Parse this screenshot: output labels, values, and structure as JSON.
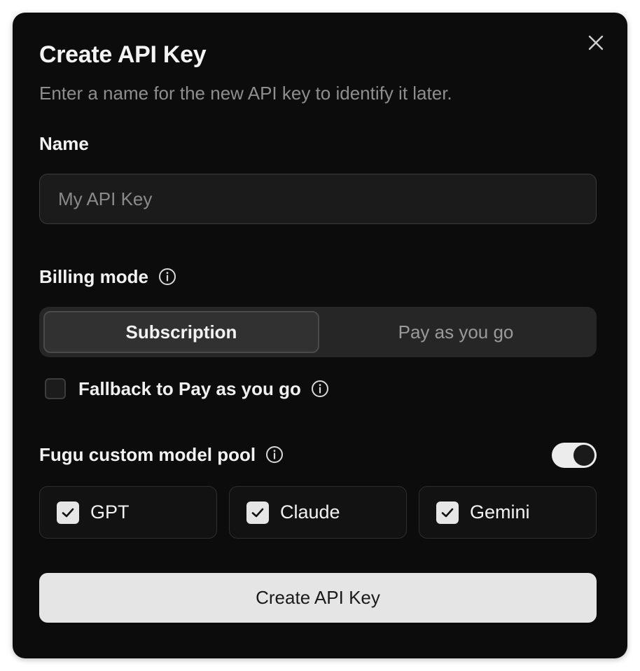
{
  "dialog": {
    "title": "Create API Key",
    "subtitle": "Enter a name for the new API key to identify it later.",
    "close_icon": "close-icon"
  },
  "name_field": {
    "label": "Name",
    "placeholder": "My API Key",
    "value": ""
  },
  "billing": {
    "label": "Billing mode",
    "info_icon": "info-icon",
    "options": [
      {
        "label": "Subscription",
        "selected": true
      },
      {
        "label": "Pay as you go",
        "selected": false
      }
    ]
  },
  "fallback": {
    "label": "Fallback to Pay as you go",
    "checked": false,
    "info_icon": "info-icon"
  },
  "model_pool": {
    "label": "Fugu custom model pool",
    "info_icon": "info-icon",
    "enabled": true,
    "models": [
      {
        "label": "GPT",
        "checked": true
      },
      {
        "label": "Claude",
        "checked": true
      },
      {
        "label": "Gemini",
        "checked": true
      }
    ]
  },
  "submit": {
    "label": "Create API Key"
  },
  "colors": {
    "dialog_bg": "#0c0c0c",
    "button_bg": "#e5e5e5",
    "muted_text": "#8e8e8e"
  }
}
